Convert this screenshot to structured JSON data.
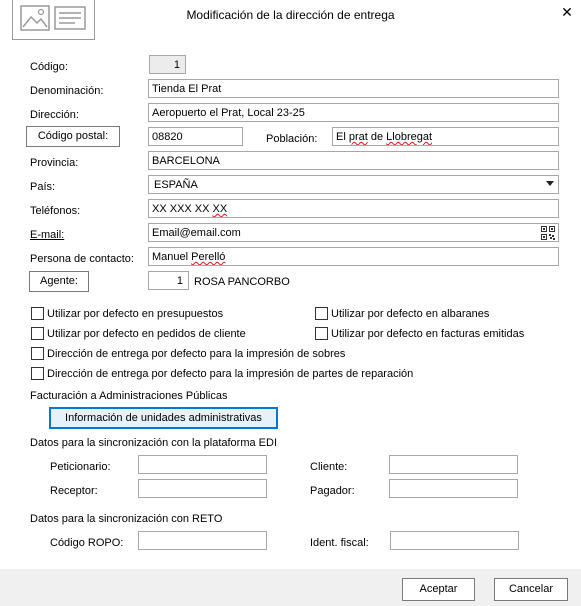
{
  "dialog": {
    "title": "Modificación de la dirección de entrega",
    "close_icon": "close-icon"
  },
  "fields": {
    "codigo": {
      "label": "Código:",
      "value": "1"
    },
    "denominacion": {
      "label": "Denominación:",
      "value": "Tienda El Prat"
    },
    "direccion": {
      "label": "Dirección:",
      "value": "Aeropuerto el Prat, Local 23-25"
    },
    "codigo_postal": {
      "label": "Código postal:",
      "value": "08820"
    },
    "poblacion": {
      "label": "Población:",
      "value_prefix": "El ",
      "value_marked": "prat",
      "value_mid": " de ",
      "value_marked2": "Llobregat"
    },
    "provincia": {
      "label": "Provincia:",
      "value": "BARCELONA"
    },
    "pais": {
      "label": "País:",
      "value": "ESPAÑA"
    },
    "telefonos": {
      "label": "Teléfonos:",
      "value_prefix": "XX XXX XX ",
      "value_marked": "XX"
    },
    "email": {
      "label": "E-mail:",
      "value": "Email@email.com",
      "icon": "qr-code-icon"
    },
    "contacto": {
      "label": "Persona de contacto:",
      "value_prefix": "Manuel ",
      "value_marked": "Perelló"
    },
    "agente": {
      "label": "Agente:",
      "value": "1",
      "name": "ROSA PANCORBO"
    }
  },
  "checkboxes": [
    {
      "label": "Utilizar por defecto en presupuestos",
      "checked": false
    },
    {
      "label": "Utilizar por defecto en albaranes",
      "checked": false
    },
    {
      "label": "Utilizar por defecto en pedidos de cliente",
      "checked": false
    },
    {
      "label": "Utilizar por defecto en facturas emitidas",
      "checked": false
    },
    {
      "label": "Dirección de entrega por defecto para la impresión de sobres",
      "checked": false
    },
    {
      "label": "Dirección de entrega por defecto para la impresión de partes de reparación",
      "checked": false
    }
  ],
  "admin": {
    "heading": "Facturación a Administraciones Públicas",
    "button": "Información de unidades administrativas"
  },
  "edi": {
    "heading": "Datos para la sincronización con la plataforma EDI",
    "peticionario": "Peticionario:",
    "cliente": "Cliente:",
    "receptor": "Receptor:",
    "pagador": "Pagador:"
  },
  "reto": {
    "heading": "Datos para la sincronización con RETO",
    "ropo": "Código ROPO:",
    "ident": "Ident. fiscal:"
  },
  "footer": {
    "accept": "Aceptar",
    "cancel": "Cancelar"
  },
  "colors": {
    "accent_border": "#0078d7",
    "admin_button_bg": "#e5f1fb",
    "spell_error": "#e0161a"
  }
}
